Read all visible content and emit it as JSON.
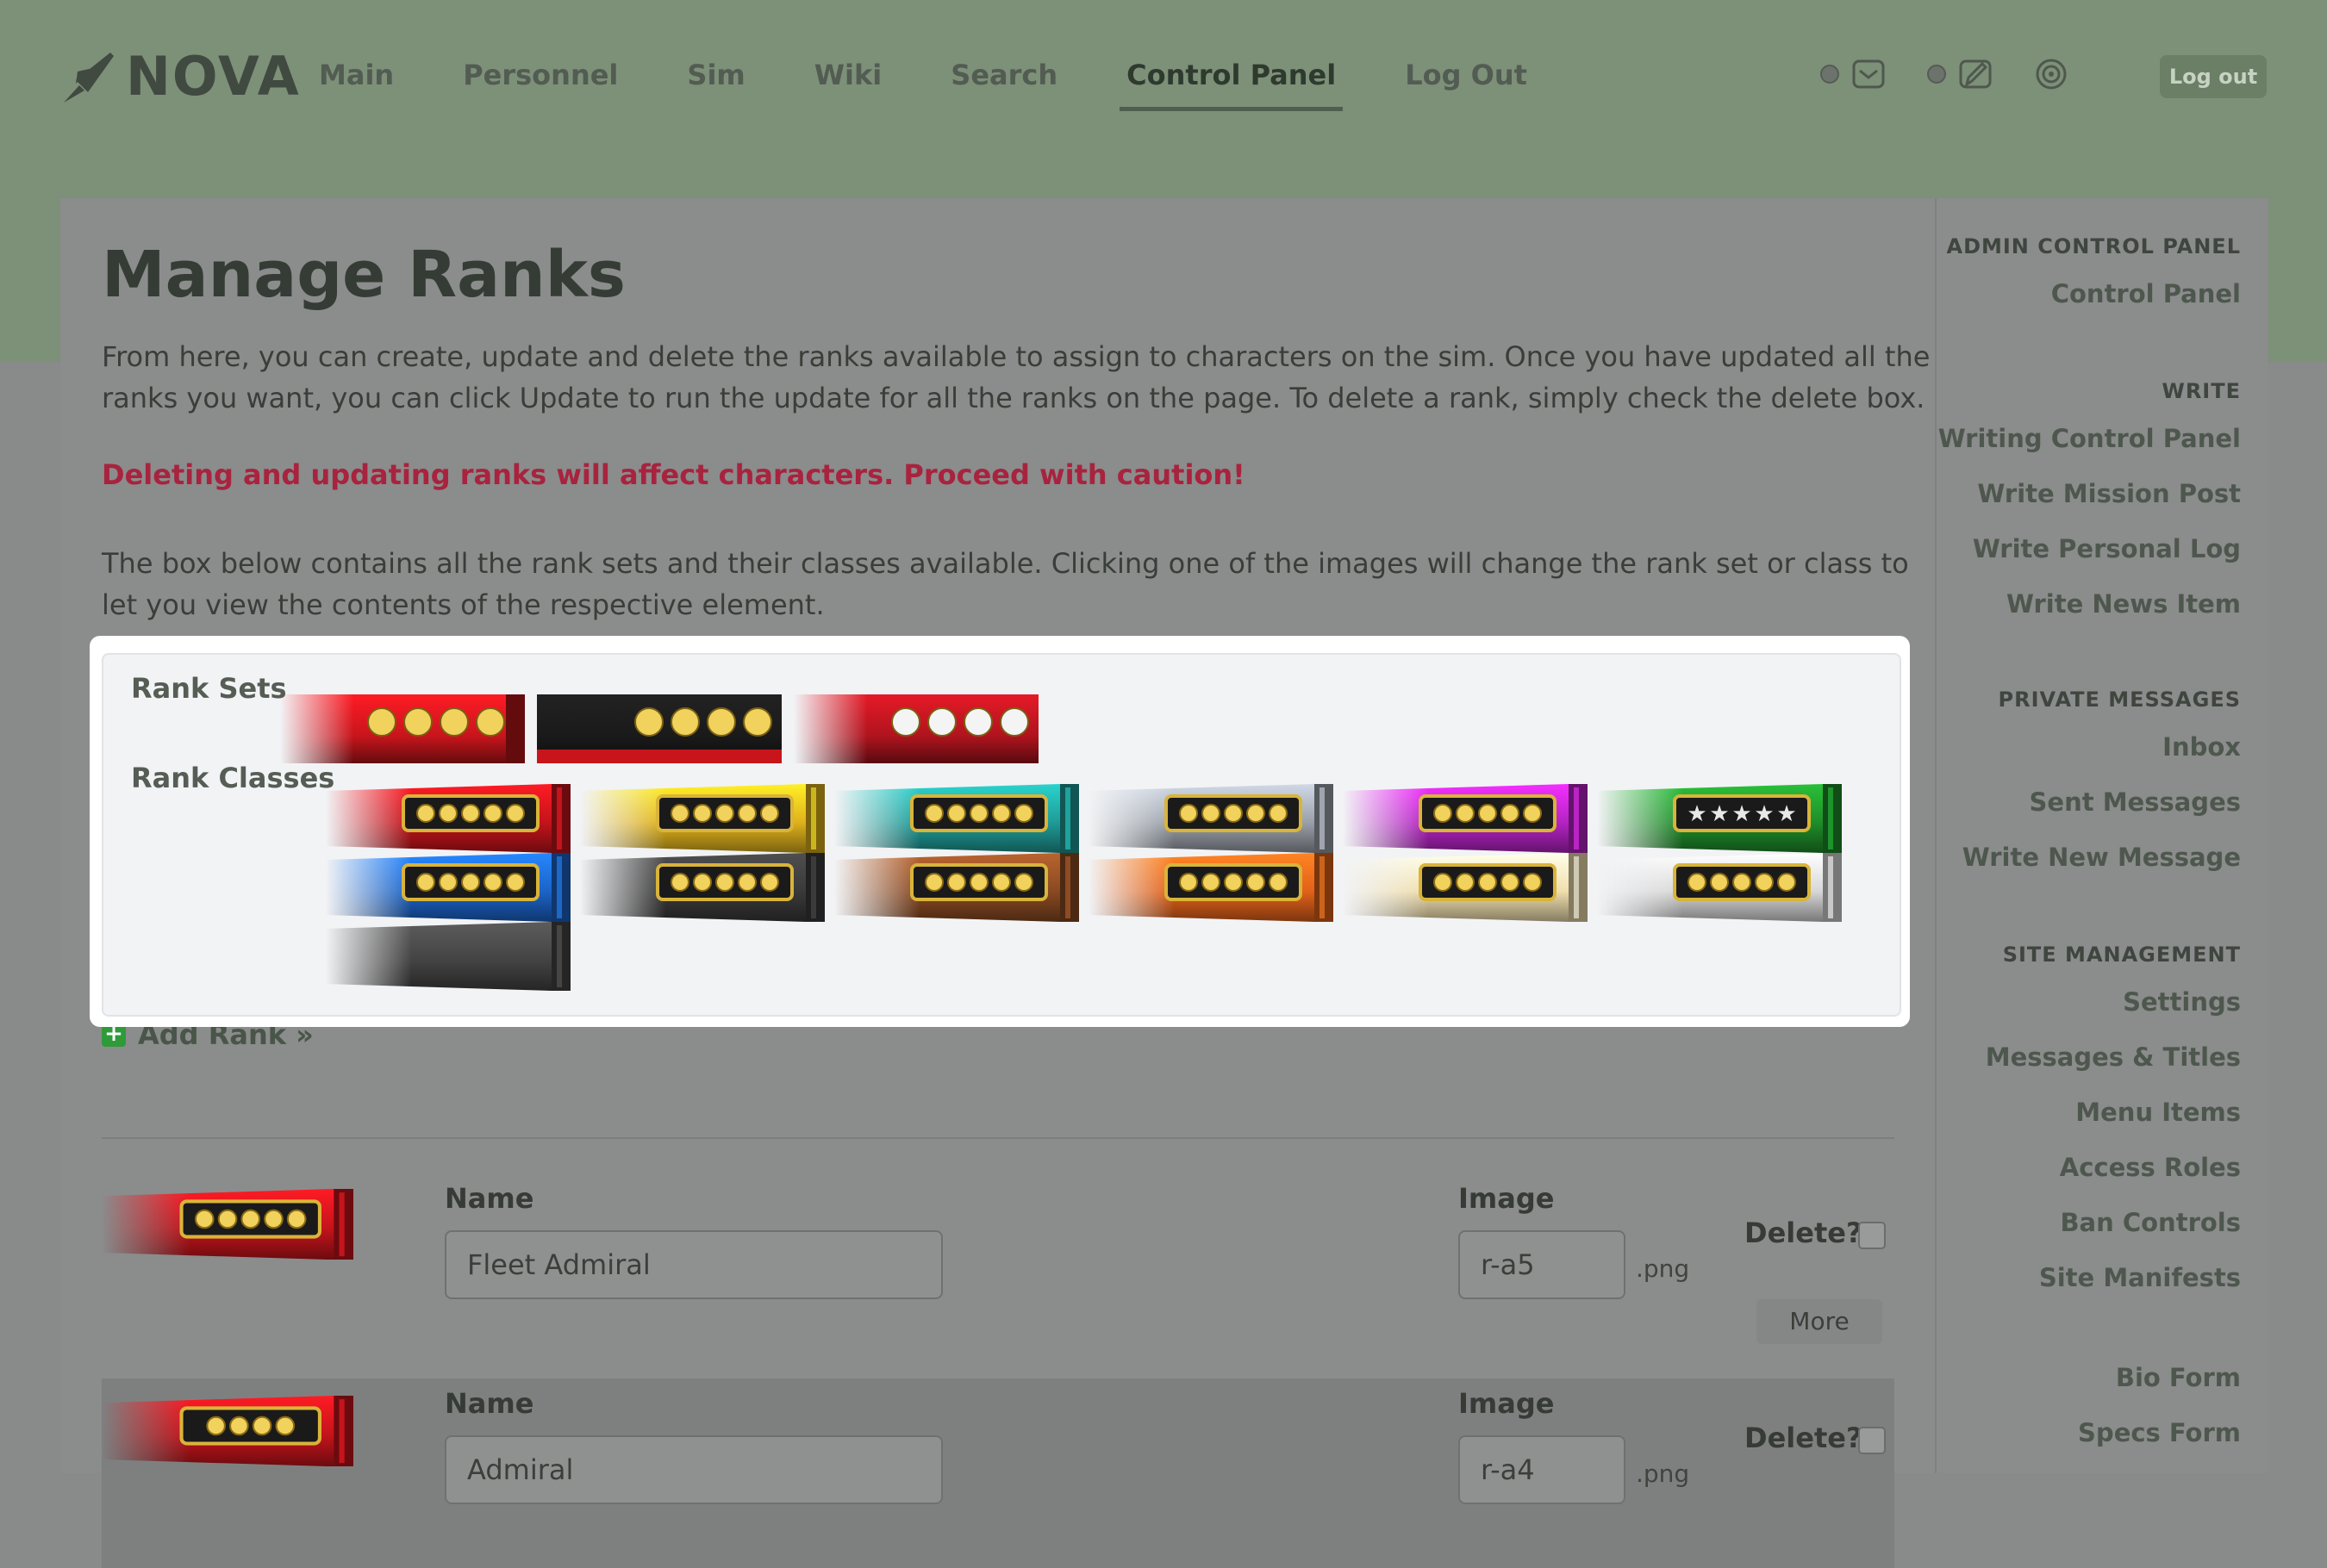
{
  "header": {
    "logo_text": "NOVA",
    "nav": [
      "Main",
      "Personnel",
      "Sim",
      "Wiki",
      "Search",
      "Control Panel",
      "Log Out"
    ],
    "active_nav": "Control Panel",
    "icons": [
      "mail-icon",
      "write-icon",
      "settings-icon"
    ],
    "logout_label": "Log out"
  },
  "page": {
    "title": "Manage Ranks",
    "intro": "From here, you can create, update and delete the ranks available to assign to characters on the sim. Once you have updated all the ranks you want, you can click Update to run the update for all the ranks on the page. To delete a rank, simply check the delete box.",
    "warning": "Deleting and updating ranks will affect characters. Proceed with caution!",
    "box_intro": "The box below contains all the rank sets and their classes available. Clicking one of the images will change the rank set or class to let you view the contents of the respective element."
  },
  "rank_box": {
    "sets_label": "Rank Sets",
    "classes_label": "Rank Classes",
    "sets": [
      {
        "name": "rank-set-1",
        "bg": "#c8151c",
        "pips": 4,
        "style": "red"
      },
      {
        "name": "rank-set-2",
        "bg": "#1a1a1a",
        "pips": 4,
        "style": "black"
      },
      {
        "name": "rank-set-3",
        "bg": "#b0141e",
        "pips": 4,
        "style": "maroon"
      }
    ],
    "classes": [
      {
        "color": "#c4141b"
      },
      {
        "color": "#e0b21c"
      },
      {
        "color": "#1f9c98"
      },
      {
        "color": "#9ba1aa"
      },
      {
        "color": "#b523c4"
      },
      {
        "color": "#1f8e2a",
        "stars": true
      },
      {
        "color": "#1c64c8"
      },
      {
        "color": "#3a3a3a"
      },
      {
        "color": "#8a4a22"
      },
      {
        "color": "#e2621a"
      },
      {
        "color": "#f0dfae"
      },
      {
        "color": "#d8d8d8"
      },
      {
        "color": "#444444",
        "blank": true
      }
    ]
  },
  "add_rank_label": "Add Rank »",
  "ranks": [
    {
      "name_label": "Name",
      "name_value": "Fleet Admiral",
      "image_label": "Image",
      "image_value": "r-a5",
      "ext": ".png",
      "delete_label": "Delete?",
      "more_label": "More",
      "pips": 5
    },
    {
      "name_label": "Name",
      "name_value": "Admiral",
      "image_label": "Image",
      "image_value": "r-a4",
      "ext": ".png",
      "delete_label": "Delete?",
      "pips": 4
    }
  ],
  "sidebar": {
    "sections": [
      {
        "title": "ADMIN CONTROL PANEL",
        "links": [
          "Control Panel"
        ]
      },
      {
        "title": "WRITE",
        "links": [
          "Writing Control Panel",
          "Write Mission Post",
          "Write Personal Log",
          "Write News Item"
        ]
      },
      {
        "title": "PRIVATE MESSAGES",
        "links": [
          "Inbox",
          "Sent Messages",
          "Write New Message"
        ]
      },
      {
        "title": "SITE MANAGEMENT",
        "links": [
          "Settings",
          "Messages & Titles",
          "Menu Items",
          "Access Roles",
          "Ban Controls",
          "Site Manifests"
        ]
      },
      {
        "title": "",
        "links": [
          "Bio Form",
          "Specs Form"
        ]
      }
    ]
  }
}
